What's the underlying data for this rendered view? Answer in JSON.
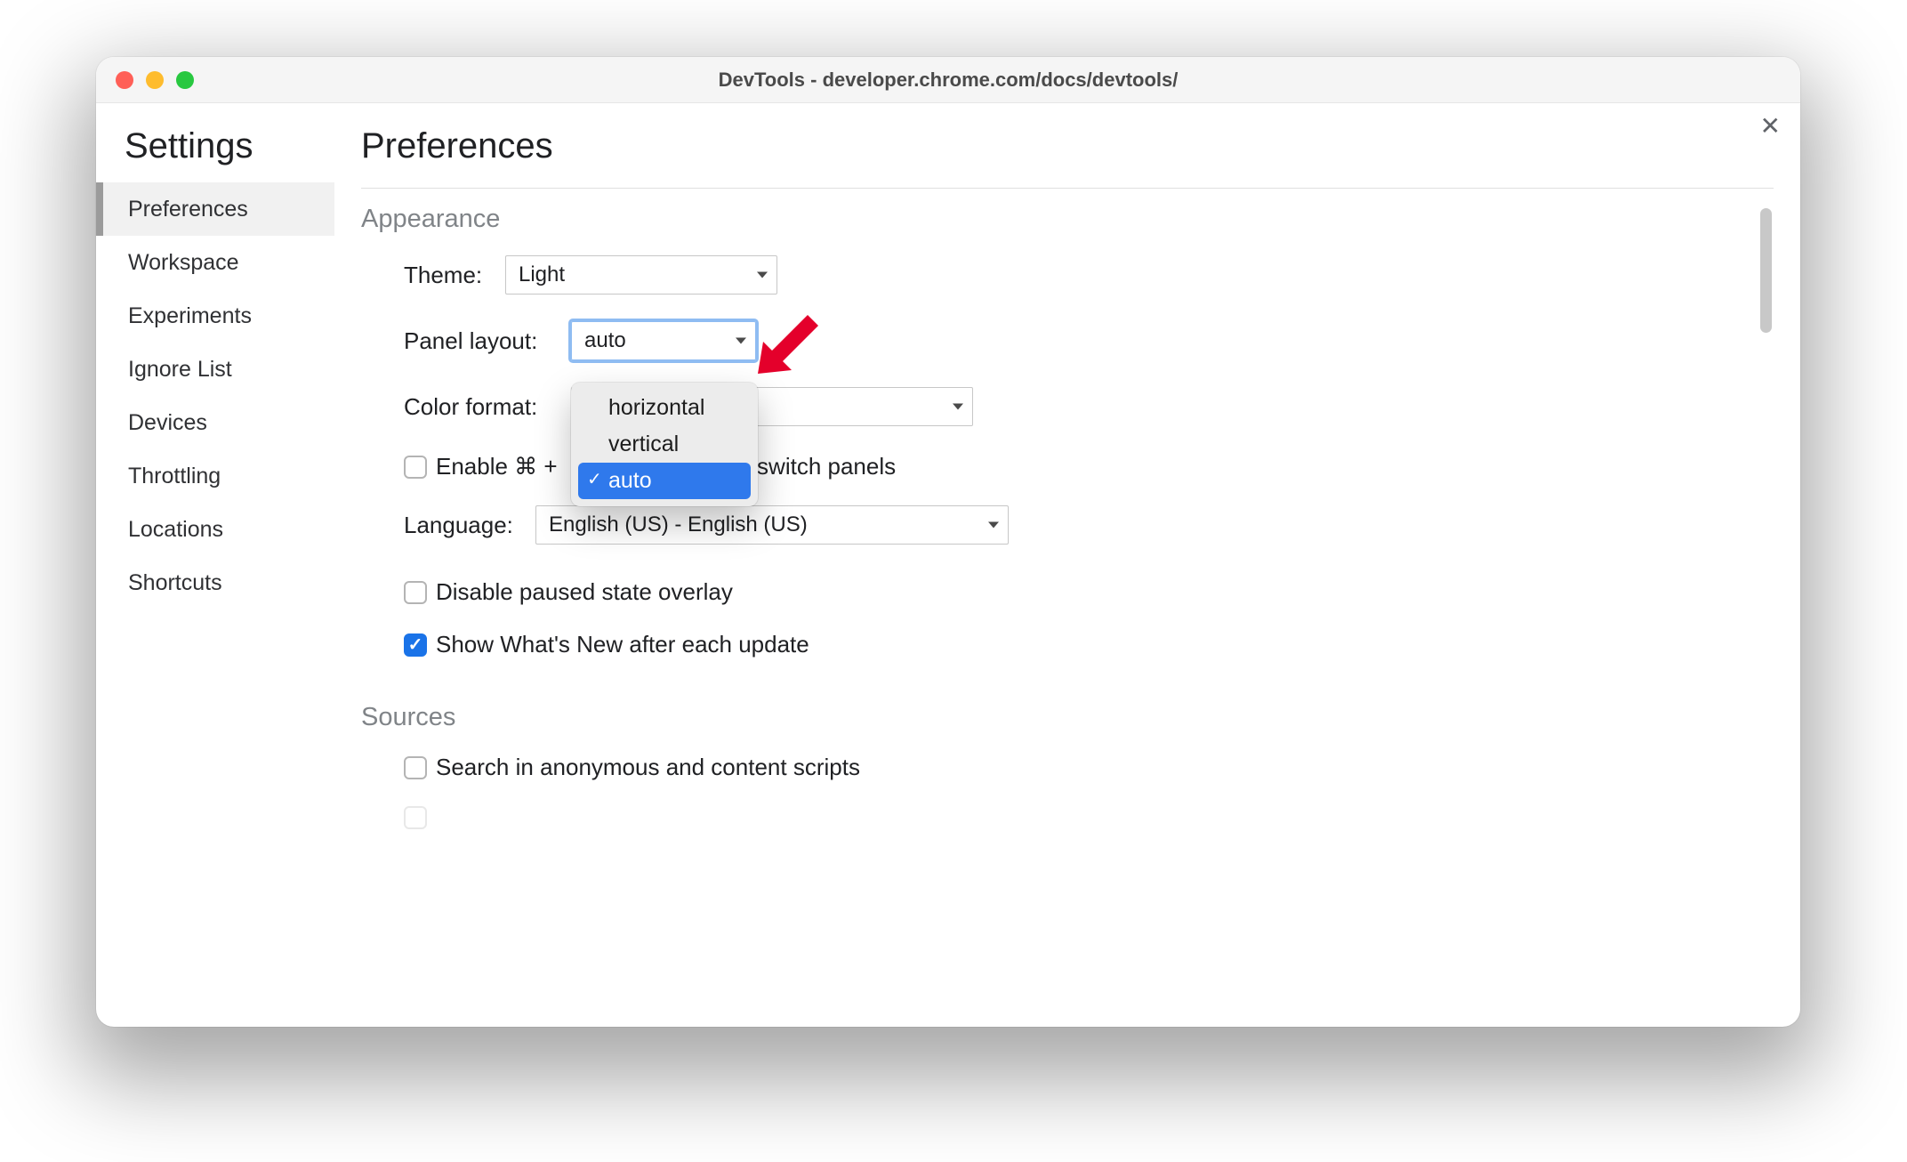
{
  "window": {
    "title": "DevTools - developer.chrome.com/docs/devtools/"
  },
  "sidebar": {
    "title": "Settings",
    "items": [
      {
        "label": "Preferences",
        "selected": true
      },
      {
        "label": "Workspace",
        "selected": false
      },
      {
        "label": "Experiments",
        "selected": false
      },
      {
        "label": "Ignore List",
        "selected": false
      },
      {
        "label": "Devices",
        "selected": false
      },
      {
        "label": "Throttling",
        "selected": false
      },
      {
        "label": "Locations",
        "selected": false
      },
      {
        "label": "Shortcuts",
        "selected": false
      }
    ]
  },
  "main": {
    "title": "Preferences",
    "appearance": {
      "header": "Appearance",
      "theme": {
        "label": "Theme:",
        "value": "Light"
      },
      "panel_layout": {
        "label": "Panel layout:",
        "value": "auto",
        "options": [
          "horizontal",
          "vertical",
          "auto"
        ],
        "open": true
      },
      "color_format": {
        "label": "Color format:",
        "value": ""
      },
      "enable_cmd_shortcut": {
        "checked": false,
        "label_prefix": "Enable ⌘ + ",
        "label_suffix": " switch panels"
      },
      "language": {
        "label": "Language:",
        "value": "English (US) - English (US)"
      },
      "disable_paused_overlay": {
        "checked": false,
        "label": "Disable paused state overlay"
      },
      "show_whatsnew": {
        "checked": true,
        "label": "Show What's New after each update"
      }
    },
    "sources": {
      "header": "Sources",
      "search_anon": {
        "checked": false,
        "label": "Search in anonymous and content scripts"
      }
    }
  },
  "annotation": {
    "arrow_color": "#e4002b"
  }
}
